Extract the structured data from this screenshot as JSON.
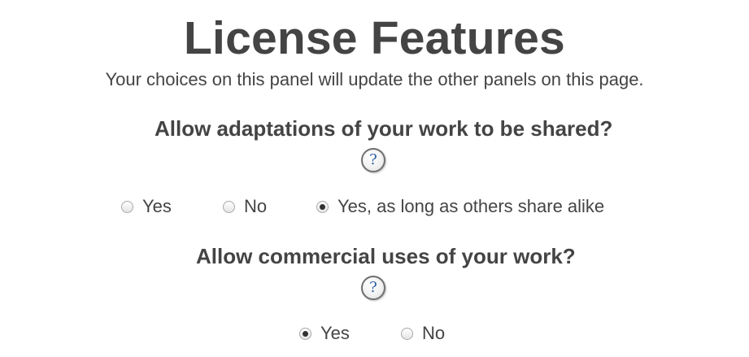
{
  "page": {
    "title": "License Features",
    "subtitle": "Your choices on this panel will update the other panels on this page."
  },
  "adaptations": {
    "question": "Allow adaptations of your work to be shared?",
    "help_glyph": "?",
    "options": [
      {
        "label": "Yes",
        "selected": false
      },
      {
        "label": "No",
        "selected": false
      },
      {
        "label": "Yes, as long as others share alike",
        "selected": true
      }
    ]
  },
  "commercial": {
    "question": "Allow commercial uses of your work?",
    "help_glyph": "?",
    "options": [
      {
        "label": "Yes",
        "selected": true
      },
      {
        "label": "No",
        "selected": false
      }
    ]
  },
  "icons": {
    "help": "question-mark-circle-icon"
  }
}
